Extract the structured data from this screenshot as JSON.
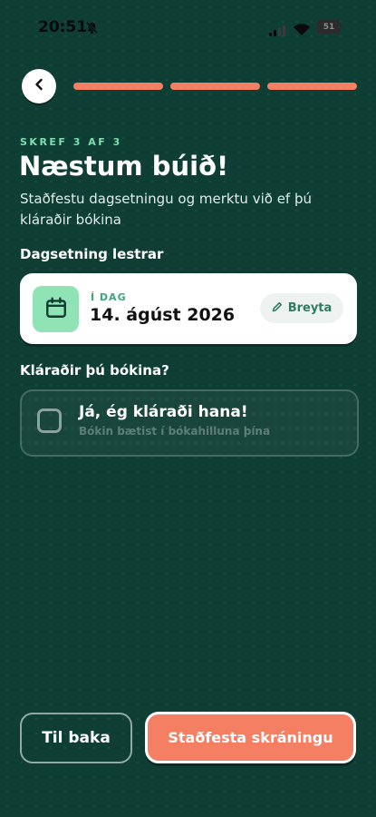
{
  "status_bar": {
    "time": "20:51",
    "battery": "51"
  },
  "progress": {
    "total_steps": 3,
    "current_step": 3
  },
  "header": {
    "step_label": "SKREF 3 AF 3",
    "title": "Næstum búið!",
    "subtitle": "Staðfestu dagsetningu og merktu við ef þú kláraðir bókina"
  },
  "date_section": {
    "label": "Dagsetning lestrar",
    "small_label": "Í DAG",
    "value": "14. ágúst 2026",
    "edit_label": "Breyta"
  },
  "finished_section": {
    "label": "Kláraðir þú bókina?",
    "checkbox_label": "Já, ég kláraði hana!",
    "checkbox_sub": "Bókin bætist í bókahilluna þína",
    "checked": false
  },
  "footer": {
    "back_label": "Til baka",
    "confirm_label": "Staðfesta skráningu"
  },
  "colors": {
    "background": "#0f3e35",
    "accent": "#f57f62",
    "mint": "#8fe3b4",
    "mint_text": "#7ddfb0"
  },
  "icons": {
    "back": "chevron-left-icon",
    "calendar": "calendar-icon",
    "edit": "pencil-icon",
    "mute": "bell-slash-icon"
  }
}
